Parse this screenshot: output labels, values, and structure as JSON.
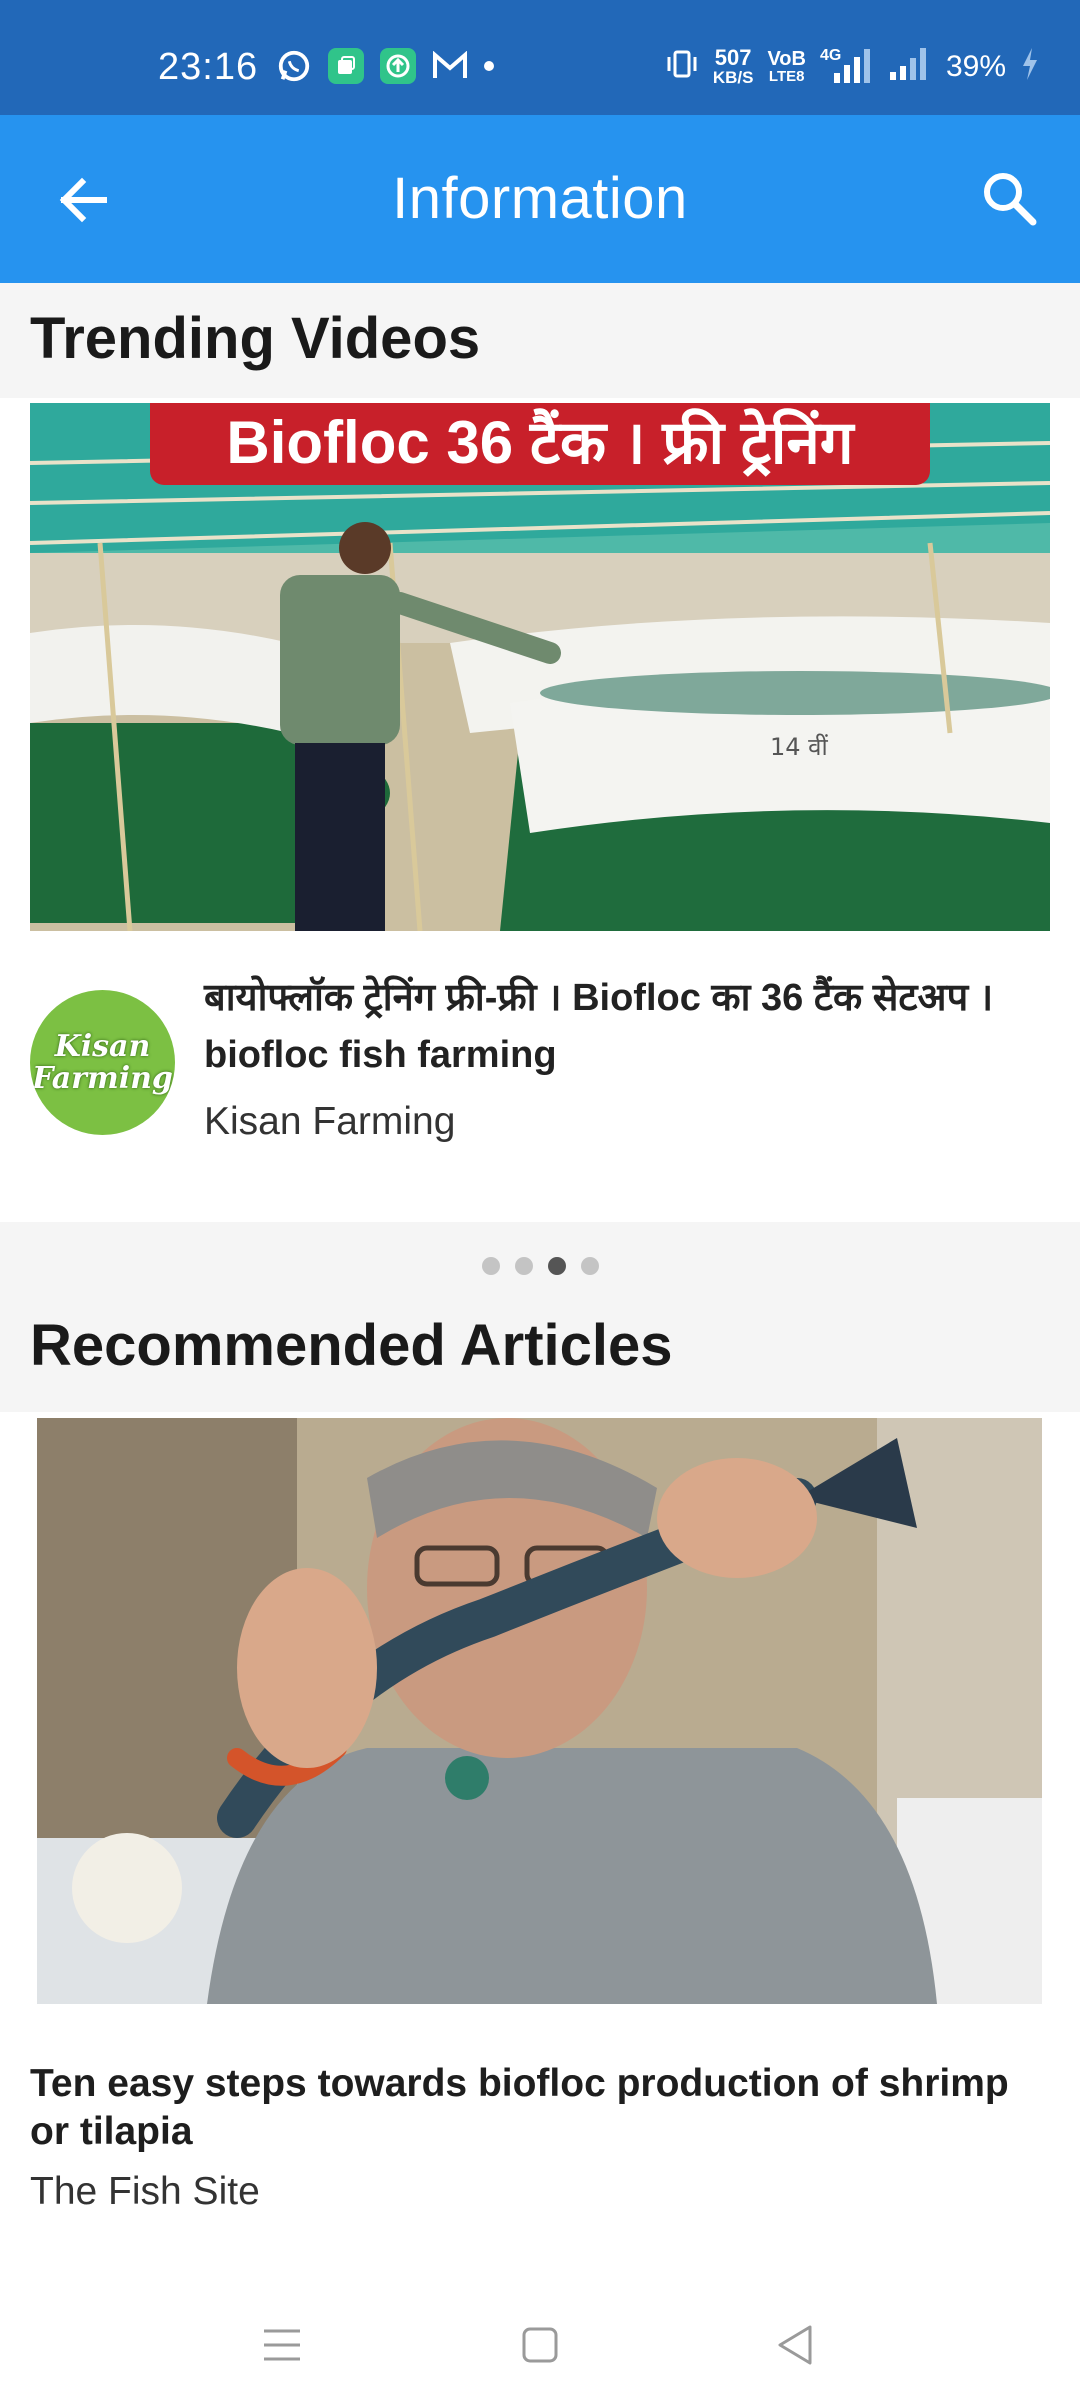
{
  "status_bar": {
    "time": "23:16",
    "net_speed_value": "507",
    "net_speed_unit": "KB/S",
    "volte_top": "VoB",
    "volte_bottom": "LTE8",
    "network_type": "4G",
    "battery": "39%",
    "notification_icons": [
      "whatsapp-icon",
      "app-square-icon",
      "upload-app-icon",
      "gmail-icon"
    ]
  },
  "app_bar": {
    "title": "Information",
    "back_icon": "arrow-left-icon",
    "search_icon": "search-icon",
    "color": "#2693ef"
  },
  "trending": {
    "heading": "Trending Videos",
    "video": {
      "thumbnail_banner": "Biofloc 36 टैंक । फ्री ट्रेनिंग",
      "thumbnail_annotation": "14 वीं",
      "title": "बायोफ्लॉक ट्रेनिंग फ्री-फ्री । Biofloc का 36 टैंक सेटअप । biofloc fish farming",
      "channel": "Kisan Farming",
      "avatar_line1": "Kisan",
      "avatar_line2": "Farming"
    },
    "pager": {
      "count": 4,
      "active_index": 2
    }
  },
  "articles": {
    "heading": "Recommended Articles",
    "article": {
      "title": "Ten easy steps towards biofloc production of shrimp or tilapia",
      "source": "The Fish Site"
    }
  },
  "nav_bar": {
    "icons": [
      "menu-icon",
      "home-square-icon",
      "back-triangle-icon"
    ]
  }
}
